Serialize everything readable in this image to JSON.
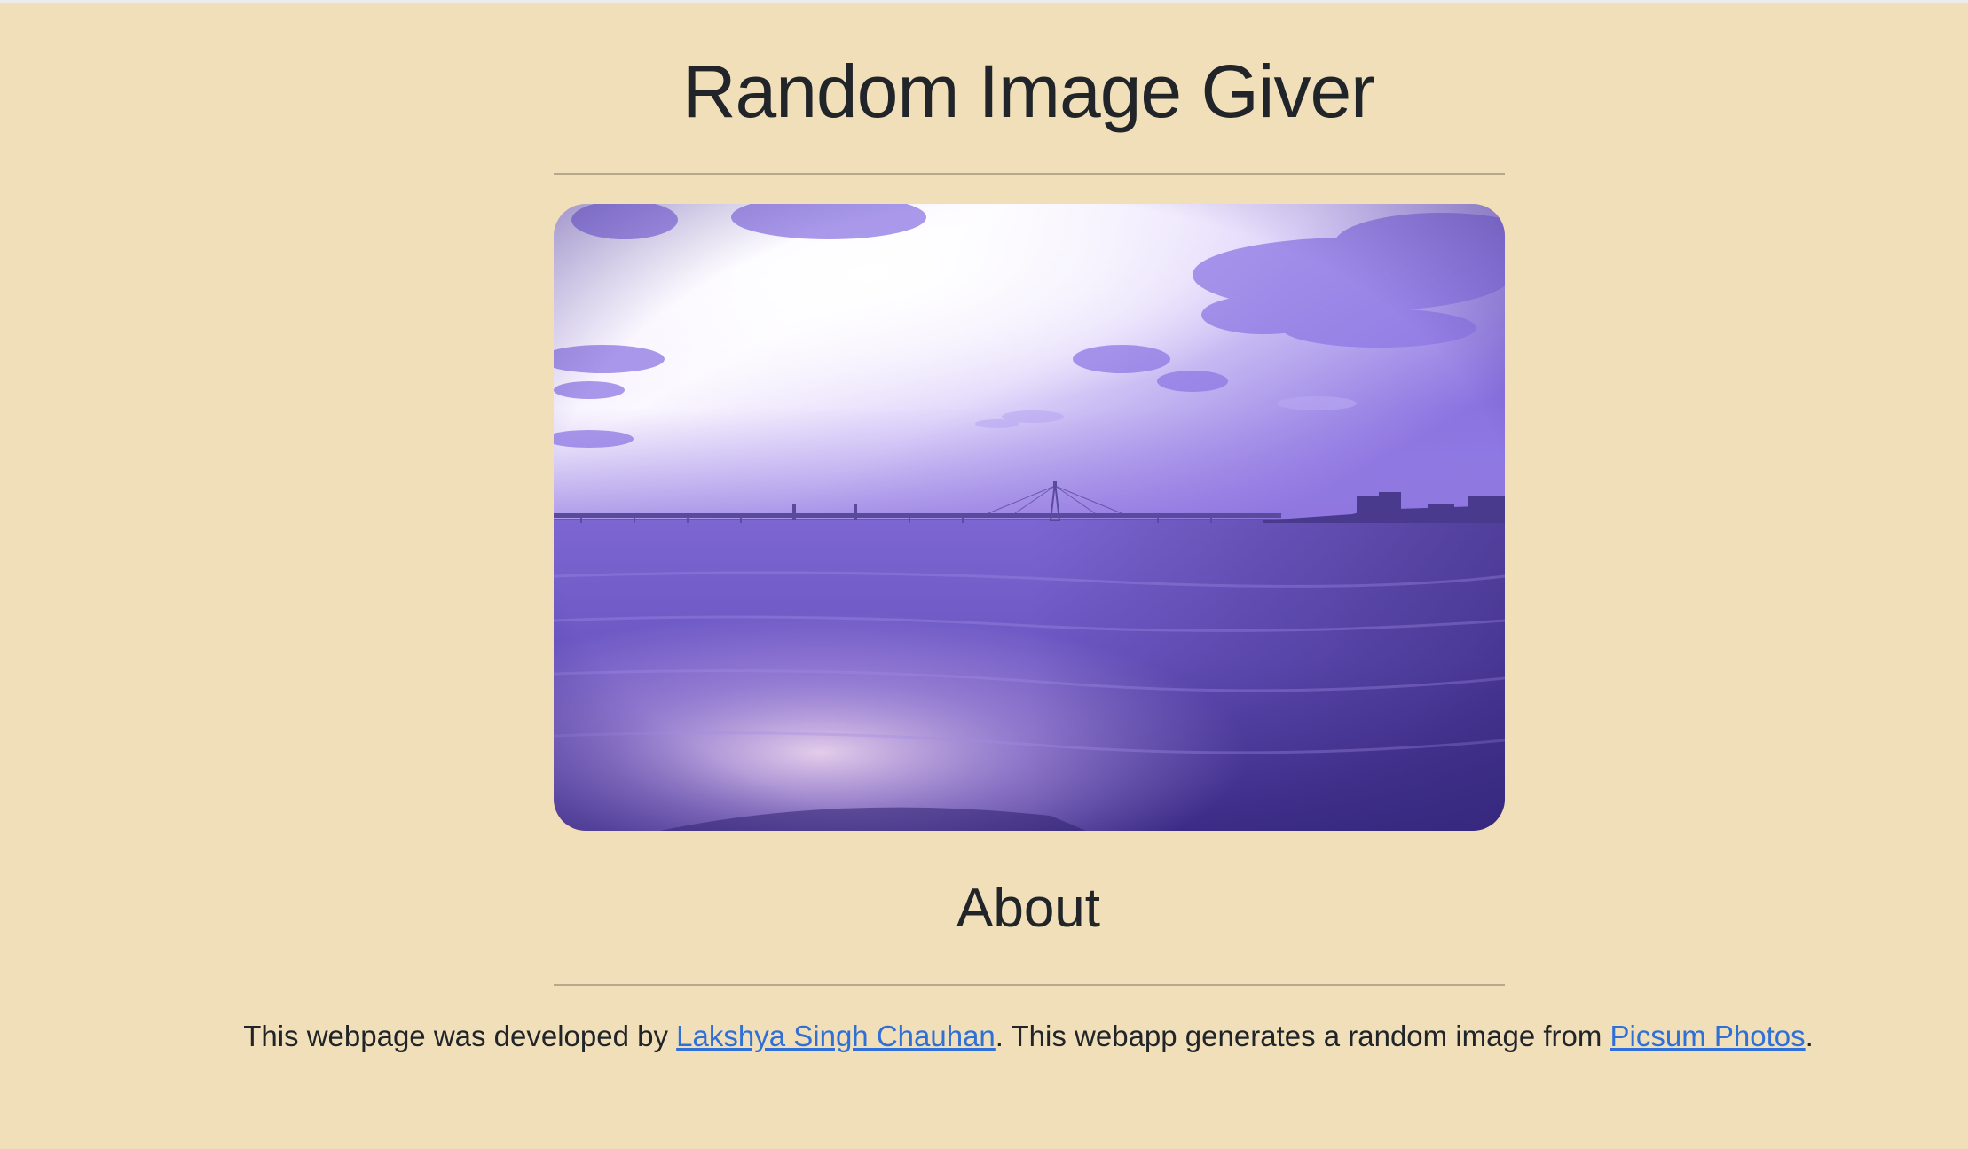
{
  "page": {
    "title": "Random Image Giver"
  },
  "image": {
    "alt": "Random image"
  },
  "about": {
    "heading": "About",
    "text_before_author": "This webpage was developed by ",
    "author_link": "Lakshya Singh Chauhan",
    "text_middle": ". This webapp generates a random image from ",
    "source_link": "Picsum Photos",
    "text_after": "."
  },
  "colors": {
    "background": "#f0dfb8",
    "text": "#212529",
    "link": "#2f6fd8",
    "rule": "#b5a88c"
  }
}
